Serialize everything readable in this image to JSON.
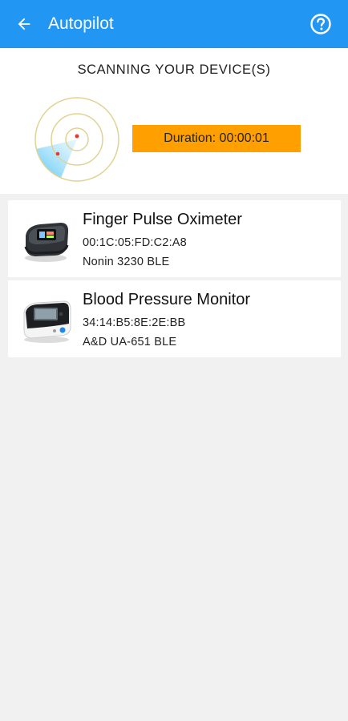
{
  "header": {
    "title": "Autopilot",
    "back_icon": "arrow-back-icon",
    "help_icon": "help-circle-icon",
    "color": "#2196f3"
  },
  "scan": {
    "title": "SCANNING YOUR DEVICE(S)",
    "duration": "Duration: 00:00:01",
    "duration_color": "#ffa000",
    "radar_icon": "radar-icon"
  },
  "devices": [
    {
      "name": "Finger Pulse Oximeter",
      "mac": "00:1C:05:FD:C2:A8",
      "model": "Nonin 3230 BLE",
      "icon": "pulse-oximeter-image"
    },
    {
      "name": "Blood Pressure Monitor",
      "mac": "34:14:B5:8E:2E:BB",
      "model": "A&D UA-651 BLE",
      "icon": "blood-pressure-monitor-image"
    }
  ]
}
